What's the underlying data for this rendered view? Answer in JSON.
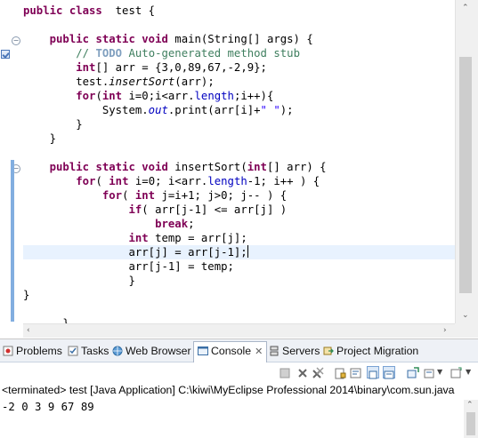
{
  "editor": {
    "lines": [
      {
        "segs": [
          [
            "kw",
            "public class"
          ],
          [
            "",
            "  test {"
          ]
        ]
      },
      {
        "segs": [
          [
            "",
            ""
          ]
        ]
      },
      {
        "segs": [
          [
            "",
            "    "
          ],
          [
            "kw",
            "public static void"
          ],
          [
            "",
            " main(String[] args) {"
          ]
        ]
      },
      {
        "segs": [
          [
            "",
            "        "
          ],
          [
            "cm",
            "// "
          ],
          [
            "tag",
            "TODO"
          ],
          [
            "cm",
            " Auto-generated method stub"
          ]
        ]
      },
      {
        "segs": [
          [
            "",
            "        "
          ],
          [
            "kw",
            "int"
          ],
          [
            "",
            "[] arr = {3,0,89,67,-2,9};"
          ]
        ]
      },
      {
        "segs": [
          [
            "",
            "        test."
          ],
          [
            "it",
            "insertSort"
          ],
          [
            "",
            "(arr);"
          ]
        ]
      },
      {
        "segs": [
          [
            "",
            "        "
          ],
          [
            "kw",
            "for"
          ],
          [
            "",
            "("
          ],
          [
            "kw",
            "int"
          ],
          [
            "",
            " i=0;i<arr."
          ],
          [
            "fld",
            "length"
          ],
          [
            "",
            ";i++){"
          ]
        ]
      },
      {
        "segs": [
          [
            "",
            "            System."
          ],
          [
            "sf",
            "out"
          ],
          [
            "",
            ".print(arr[i]+"
          ],
          [
            "str",
            "\" \""
          ],
          [
            "",
            ");"
          ]
        ]
      },
      {
        "segs": [
          [
            "",
            "        }"
          ]
        ]
      },
      {
        "segs": [
          [
            "",
            "    }"
          ]
        ]
      },
      {
        "segs": [
          [
            "",
            ""
          ]
        ]
      },
      {
        "segs": [
          [
            "",
            "    "
          ],
          [
            "kw",
            "public static void"
          ],
          [
            "",
            " insertSort("
          ],
          [
            "kw",
            "int"
          ],
          [
            "",
            "[] arr) {"
          ]
        ]
      },
      {
        "segs": [
          [
            "",
            "        "
          ],
          [
            "kw",
            "for"
          ],
          [
            "",
            "( "
          ],
          [
            "kw",
            "int"
          ],
          [
            "",
            " i=0; i<arr."
          ],
          [
            "fld",
            "length"
          ],
          [
            "",
            "-1; i++ ) {"
          ]
        ]
      },
      {
        "segs": [
          [
            "",
            "            "
          ],
          [
            "kw",
            "for"
          ],
          [
            "",
            "( "
          ],
          [
            "kw",
            "int"
          ],
          [
            "",
            " j=i+1; j>0; j-- ) {"
          ]
        ]
      },
      {
        "segs": [
          [
            "",
            "                "
          ],
          [
            "kw",
            "if"
          ],
          [
            "",
            "( arr[j-1] <= arr[j] )"
          ]
        ]
      },
      {
        "segs": [
          [
            "",
            "                    "
          ],
          [
            "kw",
            "break"
          ],
          [
            "",
            ";"
          ]
        ]
      },
      {
        "segs": [
          [
            "",
            "                "
          ],
          [
            "kw",
            "int"
          ],
          [
            "",
            " temp = arr[j];"
          ]
        ]
      },
      {
        "segs": [
          [
            "",
            "                arr[j] = arr[j-1];"
          ]
        ],
        "current": true
      },
      {
        "segs": [
          [
            "",
            "                arr[j-1] = temp;"
          ]
        ]
      },
      {
        "segs": [
          [
            "",
            "                }"
          ]
        ]
      },
      {
        "segs": [
          [
            "",
            "}"
          ]
        ]
      },
      {
        "segs": [
          [
            "",
            ""
          ]
        ]
      },
      {
        "segs": [
          [
            "",
            "      }"
          ]
        ]
      }
    ]
  },
  "view": {
    "tabs": [
      {
        "label": "Problems",
        "icon": "problems-icon",
        "active": false
      },
      {
        "label": "Tasks",
        "icon": "tasks-icon",
        "active": false
      },
      {
        "label": "Web Browser",
        "icon": "globe-icon",
        "active": false
      },
      {
        "label": "Console",
        "icon": "console-icon",
        "active": true,
        "close": "✕"
      },
      {
        "label": "Servers",
        "icon": "servers-icon",
        "active": false
      },
      {
        "label": "Project Migration",
        "icon": "migration-icon",
        "active": false
      }
    ],
    "console_title": "<terminated> test [Java Application] C:\\kiwi\\MyEclipse Professional 2014\\binary\\com.sun.java",
    "console_output": "-2 0 3 9 67 89"
  },
  "colors": {
    "keyword": "#7f0055",
    "comment": "#3f7f5f",
    "field": "#0000c0",
    "string": "#2a00ff",
    "current_line": "#e8f2fe"
  }
}
